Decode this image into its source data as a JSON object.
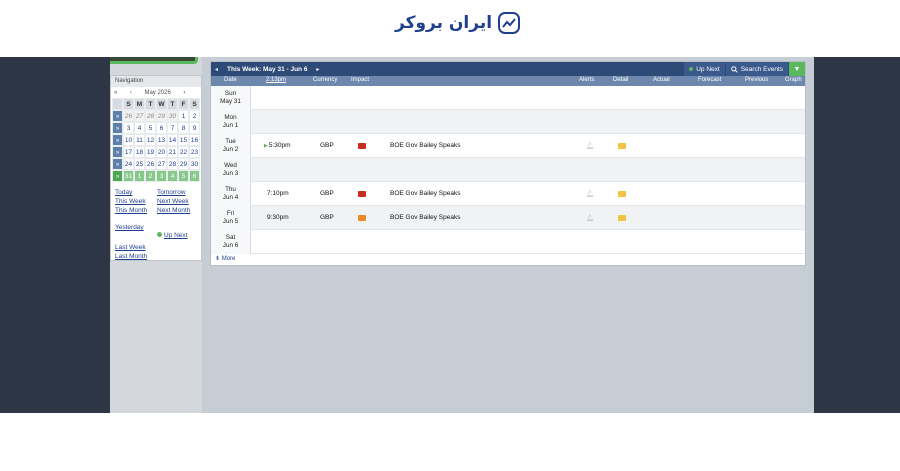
{
  "brand": {
    "logo_text": "ایران بروکر",
    "accent": "#1f3f8f"
  },
  "navigation": {
    "title": "Navigation",
    "calendar": {
      "prev_year": "«",
      "prev_month": "‹",
      "month_label": "May 2026",
      "next_month": "›",
      "weekdays": [
        "S",
        "M",
        "T",
        "W",
        "T",
        "F",
        "S"
      ],
      "weeks": [
        [
          "26",
          "27",
          "28",
          "29",
          "30",
          "1",
          "2"
        ],
        [
          "3",
          "4",
          "5",
          "6",
          "7",
          "8",
          "9"
        ],
        [
          "10",
          "11",
          "12",
          "13",
          "14",
          "15",
          "16"
        ],
        [
          "17",
          "18",
          "19",
          "20",
          "21",
          "22",
          "23"
        ],
        [
          "24",
          "25",
          "26",
          "27",
          "28",
          "29",
          "30"
        ],
        [
          "31",
          "1",
          "2",
          "3",
          "4",
          "5",
          "6"
        ]
      ],
      "week_arrow": "»"
    },
    "quick_links": {
      "today": "Today",
      "tomorrow": "Tomorrow",
      "this_week": "This Week",
      "next_week": "Next Week",
      "this_month": "This Month",
      "next_month": "Next Month",
      "yesterday": "Yesterday",
      "up_next": "Up Next",
      "last_week": "Last Week",
      "last_month": "Last Month"
    }
  },
  "toolbar": {
    "prev": "◂",
    "week_label": "This Week: May 31 - Jun 6",
    "next": "▸",
    "up_next": "Up Next",
    "search_events": "Search Events",
    "filter": "▼"
  },
  "columns": {
    "date": "Date",
    "time": "2:13pm",
    "currency": "Currency",
    "impact": "Impact",
    "alerts": "Alerts",
    "detail": "Detail",
    "actual": "Actual",
    "forecast": "Forecast",
    "previous": "Previous",
    "graph": "Graph"
  },
  "days": [
    {
      "dow": "Sun",
      "date": "May 31"
    },
    {
      "dow": "Mon",
      "date": "Jun 1"
    },
    {
      "dow": "Tue",
      "date": "Jun 2"
    },
    {
      "dow": "Wed",
      "date": "Jun 3"
    },
    {
      "dow": "Thu",
      "date": "Jun 4"
    },
    {
      "dow": "Fri",
      "date": "Jun 5"
    },
    {
      "dow": "Sat",
      "date": "Jun 6"
    }
  ],
  "events": [
    {
      "time": "5:30pm",
      "currency": "GBP",
      "impact": "high",
      "title": "BOE Gov Bailey Speaks"
    },
    {
      "time": "7:10pm",
      "currency": "GBP",
      "impact": "high",
      "title": "BOE Gov Bailey Speaks"
    },
    {
      "time": "9:30pm",
      "currency": "GBP",
      "impact": "medium",
      "title": "BOE Gov Bailey Speaks"
    }
  ],
  "more_link": "More",
  "more_icon": "⇟"
}
